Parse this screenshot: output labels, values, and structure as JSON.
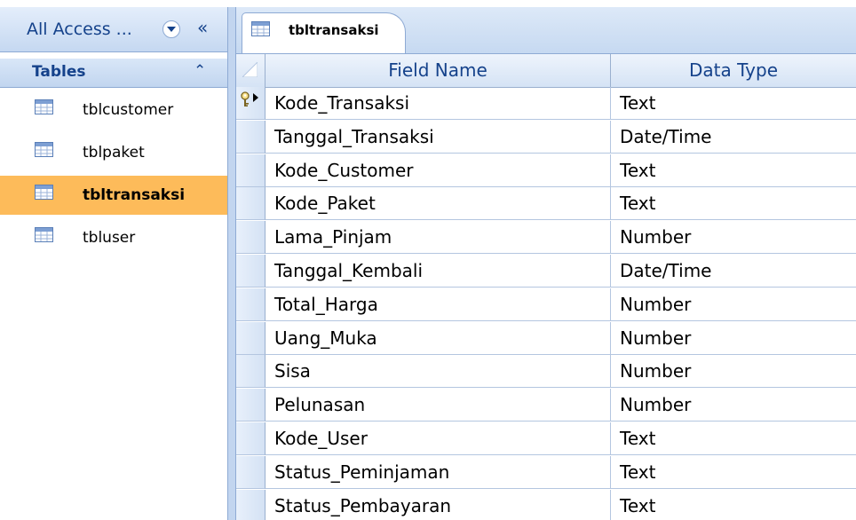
{
  "nav": {
    "header_title": "All Access ...",
    "group_title": "Tables",
    "items": [
      {
        "label": "tblcustomer",
        "selected": false
      },
      {
        "label": "tblpaket",
        "selected": false
      },
      {
        "label": "tbltransaksi",
        "selected": true
      },
      {
        "label": "tbluser",
        "selected": false
      }
    ]
  },
  "tab": {
    "label": "tbltransaksi"
  },
  "grid": {
    "columns": [
      "Field Name",
      "Data Type"
    ],
    "rows": [
      {
        "field": "Kode_Transaksi",
        "type": "Text",
        "primary_key": true
      },
      {
        "field": "Tanggal_Transaksi",
        "type": "Date/Time"
      },
      {
        "field": "Kode_Customer",
        "type": "Text"
      },
      {
        "field": "Kode_Paket",
        "type": "Text"
      },
      {
        "field": "Lama_Pinjam",
        "type": "Number"
      },
      {
        "field": "Tanggal_Kembali",
        "type": "Date/Time"
      },
      {
        "field": "Total_Harga",
        "type": "Number"
      },
      {
        "field": "Uang_Muka",
        "type": "Number"
      },
      {
        "field": "Sisa",
        "type": "Number"
      },
      {
        "field": "Pelunasan",
        "type": "Number"
      },
      {
        "field": "Kode_User",
        "type": "Text"
      },
      {
        "field": "Status_Peminjaman",
        "type": "Text"
      },
      {
        "field": "Status_Pembayaran",
        "type": "Text"
      }
    ]
  },
  "colors": {
    "selected_item": "#fdbb5a",
    "header_text": "#15428b",
    "border": "#8eaad4"
  }
}
